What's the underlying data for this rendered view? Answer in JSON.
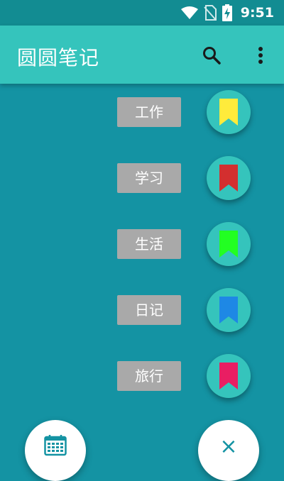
{
  "status_bar": {
    "time": "9:51",
    "icons": [
      "wifi-icon",
      "no-sim-icon",
      "battery-charging-icon"
    ]
  },
  "app_bar": {
    "title": "圆圆笔记",
    "actions": [
      "search-icon",
      "more-vert-icon"
    ]
  },
  "menu": {
    "items": [
      {
        "label": "工作",
        "icon": "bookmark-icon",
        "color": "#ffeb3b"
      },
      {
        "label": "学习",
        "icon": "bookmark-icon",
        "color": "#d32f2f"
      },
      {
        "label": "生活",
        "icon": "bookmark-icon",
        "color": "#22ff22"
      },
      {
        "label": "日记",
        "icon": "bookmark-icon",
        "color": "#1e88e5"
      },
      {
        "label": "旅行",
        "icon": "bookmark-icon",
        "color": "#e91e63"
      }
    ]
  },
  "fabs": {
    "left_icon": "calendar-icon",
    "right_icon": "close-icon",
    "close_glyph": "×"
  },
  "colors": {
    "background": "#1493a3",
    "app_bar": "#35c4bc",
    "status_bar": "#128c92",
    "label_bg": "#a9a9a9"
  }
}
